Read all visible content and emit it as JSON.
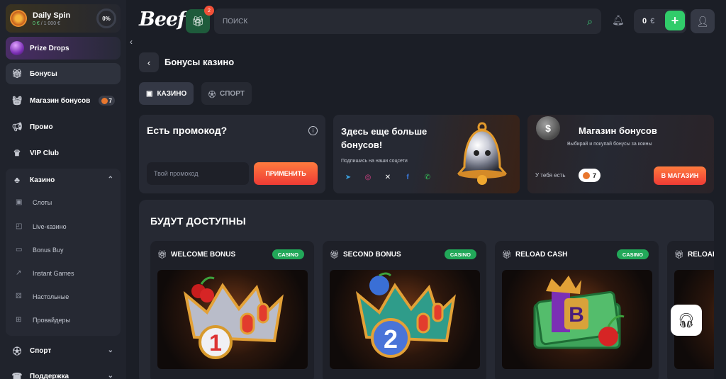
{
  "sidebar": {
    "daily_spin": {
      "title": "Daily Spin",
      "progress_text": "0 €",
      "progress_total": "/ 1 000 €",
      "percent": "0%"
    },
    "prize_drops": "Prize Drops",
    "items": [
      {
        "label": "Бонусы",
        "icon": "gift-icon",
        "active": true
      },
      {
        "label": "Магазин бонусов",
        "icon": "basket-icon",
        "badge": "7"
      },
      {
        "label": "Промо",
        "icon": "megaphone-icon"
      },
      {
        "label": "VIP Club",
        "icon": "crown-icon"
      },
      {
        "label": "Казино",
        "icon": "cards-icon"
      }
    ],
    "casino_sub": [
      "Слоты",
      "Live-казино",
      "Bonus Buy",
      "Instant Games",
      "Настольные",
      "Провайдеры"
    ],
    "sport": "Спорт",
    "support": "Поддержка"
  },
  "header": {
    "logo": "Beef",
    "gift_count": "2",
    "search_placeholder": "ПОИСК",
    "balance": "0",
    "currency": "€"
  },
  "page": {
    "title": "Бонусы казино",
    "tabs": [
      "КАЗИНО",
      "СПОРТ"
    ]
  },
  "promo_card": {
    "title": "Есть промокод?",
    "input_placeholder": "Твой промокод",
    "apply": "ПРИМЕНИТЬ"
  },
  "social_card": {
    "title": "Здесь еще больше бонусов!",
    "subtitle": "Подпишись на наши соцсети"
  },
  "shop_card": {
    "title": "Магазин бонусов",
    "desc": "Выбирай и покупай бонусы за коины",
    "have": "У тебя есть",
    "coins": "7",
    "button": "В МАГАЗИН"
  },
  "upcoming": {
    "title": "БУДУТ ДОСТУПНЫ",
    "bonuses": [
      {
        "name": "WELCOME BONUS",
        "tag": "CASINO"
      },
      {
        "name": "SECOND BONUS",
        "tag": "CASINO"
      },
      {
        "name": "RELOAD CASH",
        "tag": "CASINO"
      },
      {
        "name": "RELOAD"
      }
    ]
  },
  "colors": {
    "accent_green": "#31cc6a",
    "accent_orange": "#f0533a",
    "bg": "#1b1e26"
  }
}
